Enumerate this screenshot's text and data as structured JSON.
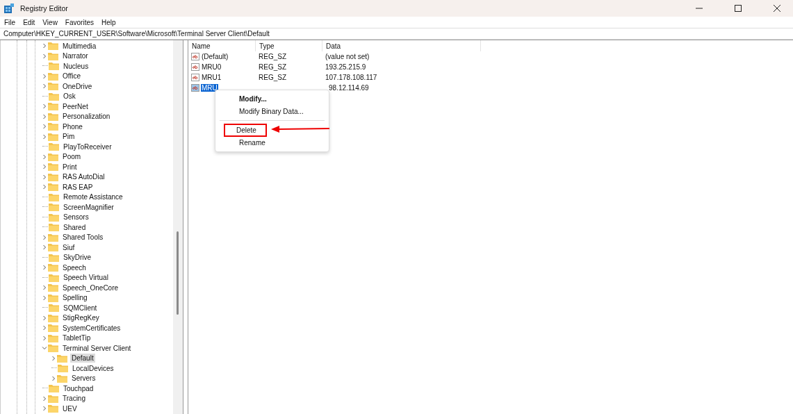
{
  "window": {
    "title": "Registry Editor"
  },
  "menu_bar": [
    "File",
    "Edit",
    "View",
    "Favorites",
    "Help"
  ],
  "address": "Computer\\HKEY_CURRENT_USER\\Software\\Microsoft\\Terminal Server Client\\Default",
  "tree": [
    {
      "label": "Multimedia",
      "has_children": true,
      "expanded": false,
      "selected": false
    },
    {
      "label": "Narrator",
      "has_children": true,
      "expanded": false,
      "selected": false
    },
    {
      "label": "Nucleus",
      "has_children": false,
      "expanded": false,
      "selected": false
    },
    {
      "label": "Office",
      "has_children": true,
      "expanded": false,
      "selected": false
    },
    {
      "label": "OneDrive",
      "has_children": true,
      "expanded": false,
      "selected": false
    },
    {
      "label": "Osk",
      "has_children": false,
      "expanded": false,
      "selected": false
    },
    {
      "label": "PeerNet",
      "has_children": true,
      "expanded": false,
      "selected": false
    },
    {
      "label": "Personalization",
      "has_children": true,
      "expanded": false,
      "selected": false
    },
    {
      "label": "Phone",
      "has_children": true,
      "expanded": false,
      "selected": false
    },
    {
      "label": "Pim",
      "has_children": true,
      "expanded": false,
      "selected": false
    },
    {
      "label": "PlayToReceiver",
      "has_children": false,
      "expanded": false,
      "selected": false
    },
    {
      "label": "Poom",
      "has_children": true,
      "expanded": false,
      "selected": false
    },
    {
      "label": "Print",
      "has_children": true,
      "expanded": false,
      "selected": false
    },
    {
      "label": "RAS AutoDial",
      "has_children": true,
      "expanded": false,
      "selected": false
    },
    {
      "label": "RAS EAP",
      "has_children": true,
      "expanded": false,
      "selected": false
    },
    {
      "label": "Remote Assistance",
      "has_children": false,
      "expanded": false,
      "selected": false
    },
    {
      "label": "ScreenMagnifier",
      "has_children": false,
      "expanded": false,
      "selected": false
    },
    {
      "label": "Sensors",
      "has_children": false,
      "expanded": false,
      "selected": false
    },
    {
      "label": "Shared",
      "has_children": false,
      "expanded": false,
      "selected": false
    },
    {
      "label": "Shared Tools",
      "has_children": true,
      "expanded": false,
      "selected": false
    },
    {
      "label": "Siuf",
      "has_children": true,
      "expanded": false,
      "selected": false
    },
    {
      "label": "SkyDrive",
      "has_children": false,
      "expanded": false,
      "selected": false
    },
    {
      "label": "Speech",
      "has_children": true,
      "expanded": false,
      "selected": false
    },
    {
      "label": "Speech Virtual",
      "has_children": false,
      "expanded": false,
      "selected": false
    },
    {
      "label": "Speech_OneCore",
      "has_children": true,
      "expanded": false,
      "selected": false
    },
    {
      "label": "Spelling",
      "has_children": true,
      "expanded": false,
      "selected": false
    },
    {
      "label": "SQMClient",
      "has_children": false,
      "expanded": false,
      "selected": false
    },
    {
      "label": "StigRegKey",
      "has_children": true,
      "expanded": false,
      "selected": false
    },
    {
      "label": "SystemCertificates",
      "has_children": true,
      "expanded": false,
      "selected": false
    },
    {
      "label": "TabletTip",
      "has_children": true,
      "expanded": false,
      "selected": false
    },
    {
      "label": "Terminal Server Client",
      "has_children": true,
      "expanded": true,
      "selected": false,
      "children": [
        {
          "label": "Default",
          "has_children": true,
          "expanded": false,
          "selected": true
        },
        {
          "label": "LocalDevices",
          "has_children": false,
          "expanded": false,
          "selected": false
        },
        {
          "label": "Servers",
          "has_children": true,
          "expanded": false,
          "selected": false
        }
      ]
    },
    {
      "label": "Touchpad",
      "has_children": false,
      "expanded": false,
      "selected": false
    },
    {
      "label": "Tracing",
      "has_children": true,
      "expanded": false,
      "selected": false
    },
    {
      "label": "UEV",
      "has_children": true,
      "expanded": false,
      "selected": false
    }
  ],
  "table": {
    "columns": [
      "Name",
      "Type",
      "Data"
    ],
    "rows": [
      {
        "name": "(Default)",
        "type": "REG_SZ",
        "data": "(value not set)",
        "selected": false
      },
      {
        "name": "MRU0",
        "type": "REG_SZ",
        "data": "193.25.215.9",
        "selected": false
      },
      {
        "name": "MRU1",
        "type": "REG_SZ",
        "data": "107.178.108.117",
        "selected": false
      },
      {
        "name": "MRU",
        "data": "98.12.114.69",
        "selected": true
      }
    ]
  },
  "context_menu": [
    {
      "kind": "item",
      "label": "Modify...",
      "default": true,
      "selected": false
    },
    {
      "kind": "item",
      "label": "Modify Binary Data...",
      "default": false,
      "selected": false
    },
    {
      "kind": "separator"
    },
    {
      "kind": "item",
      "label": "Delete",
      "default": false,
      "selected": true
    },
    {
      "kind": "item",
      "label": "Rename",
      "default": false,
      "selected": false
    }
  ]
}
